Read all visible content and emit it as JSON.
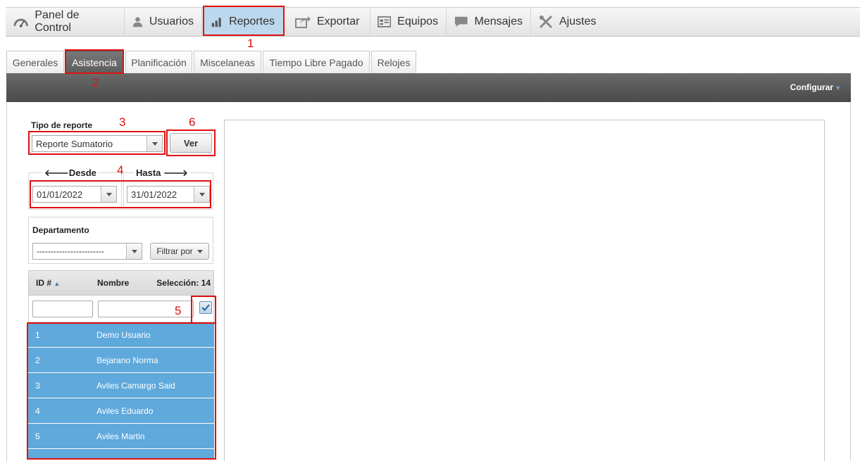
{
  "nav": {
    "items": [
      {
        "label": "Panel de Control",
        "icon": "dashboard-icon"
      },
      {
        "label": "Usuarios",
        "icon": "user-icon"
      },
      {
        "label": "Reportes",
        "icon": "bar-chart-icon",
        "active": true
      },
      {
        "label": "Exportar",
        "icon": "export-icon"
      },
      {
        "label": "Equipos",
        "icon": "devices-icon"
      },
      {
        "label": "Mensajes",
        "icon": "message-icon"
      },
      {
        "label": "Ajustes",
        "icon": "tools-icon"
      }
    ]
  },
  "tabs": [
    {
      "label": "Generales"
    },
    {
      "label": "Asistencia",
      "active": true
    },
    {
      "label": "Planificación"
    },
    {
      "label": "Miscelaneas"
    },
    {
      "label": "Tiempo Libre Pagado"
    },
    {
      "label": "Relojes"
    }
  ],
  "toolbar": {
    "configurar_label": "Configurar"
  },
  "report": {
    "tipo_label": "Tipo de reporte",
    "tipo_value": "Reporte Sumatorio",
    "ver_label": "Ver"
  },
  "range": {
    "desde_label": "Desde",
    "hasta_label": "Hasta",
    "desde_value": "01/01/2022",
    "hasta_value": "31/01/2022"
  },
  "department": {
    "label": "Departamento",
    "value": "------------------------",
    "filter_label": "Filtrar por"
  },
  "grid": {
    "col_id": "ID #",
    "col_name": "Nombre",
    "selection_label": "Selección: 14",
    "rows": [
      {
        "id": "1",
        "name": "Demo Usuario"
      },
      {
        "id": "2",
        "name": "Bejarano Norma"
      },
      {
        "id": "3",
        "name": "Aviles Camargo Said"
      },
      {
        "id": "4",
        "name": "Aviles Eduardo"
      },
      {
        "id": "5",
        "name": "Aviles Martin"
      }
    ]
  },
  "annotations": [
    "1",
    "2",
    "3",
    "4",
    "5",
    "6"
  ],
  "colors": {
    "annotation": "#e01010",
    "row_selected": "#5fa9dc",
    "active_nav": "#bcd8ee"
  }
}
